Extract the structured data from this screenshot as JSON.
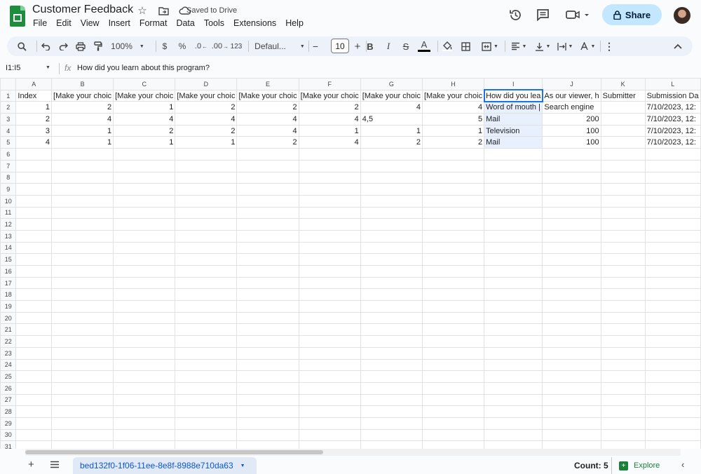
{
  "header": {
    "doc_title": "Customer Feedback",
    "saved_status": "Saved to Drive",
    "share_label": "Share",
    "menu": [
      "File",
      "Edit",
      "View",
      "Insert",
      "Format",
      "Data",
      "Tools",
      "Extensions",
      "Help"
    ]
  },
  "toolbar": {
    "zoom": "100%",
    "currency": "$",
    "percent": "%",
    "dec_decrease": ".0",
    "dec_increase": ".00",
    "number_format": "123",
    "font": "Defaul...",
    "minus": "−",
    "font_size": "10",
    "plus": "+",
    "bold": "B",
    "italic": "I",
    "strike": "S",
    "text_color": "A"
  },
  "formula_bar": {
    "name_box": "I1:I5",
    "fx": "fx",
    "value": "How did you learn about this program?"
  },
  "sheet": {
    "columns": [
      "A",
      "B",
      "C",
      "D",
      "E",
      "F",
      "G",
      "H",
      "I",
      "J",
      "K",
      "L"
    ],
    "selected_column": "I",
    "rows": [
      [
        "Index",
        "[Make your choic",
        "[Make your choic",
        "[Make your choic",
        "[Make your choic",
        "[Make your choic",
        "[Make your choic",
        "[Make your choic",
        "How did you lea",
        "As our viewer, h",
        "Submitter",
        "Submission Da"
      ],
      [
        "1",
        "2",
        "1",
        "2",
        "2",
        "2",
        "4",
        "4",
        "Word of mouth |",
        "Search engine",
        "",
        "7/10/2023, 12:"
      ],
      [
        "2",
        "4",
        "4",
        "4",
        "4",
        "4",
        "4,5",
        "5",
        "Mail",
        "200",
        "",
        "7/10/2023, 12:"
      ],
      [
        "3",
        "1",
        "2",
        "2",
        "4",
        "1",
        "1",
        "1",
        "Television",
        "100",
        "",
        "7/10/2023, 12:"
      ],
      [
        "4",
        "1",
        "1",
        "1",
        "2",
        "4",
        "2",
        "2",
        "Mail",
        "100",
        "",
        "7/10/2023, 12:"
      ]
    ],
    "total_rows": 31
  },
  "bottom": {
    "sheet_tab": "bed132f0-1f06-11ee-8e8f-8988e710da63",
    "count": "Count: 5",
    "explore": "Explore"
  },
  "colors": {
    "accent": "#1a73e8",
    "share_bg": "#c2e7ff",
    "sheets_green": "#1e8e3e",
    "selection_bg": "#e8f0fe"
  }
}
